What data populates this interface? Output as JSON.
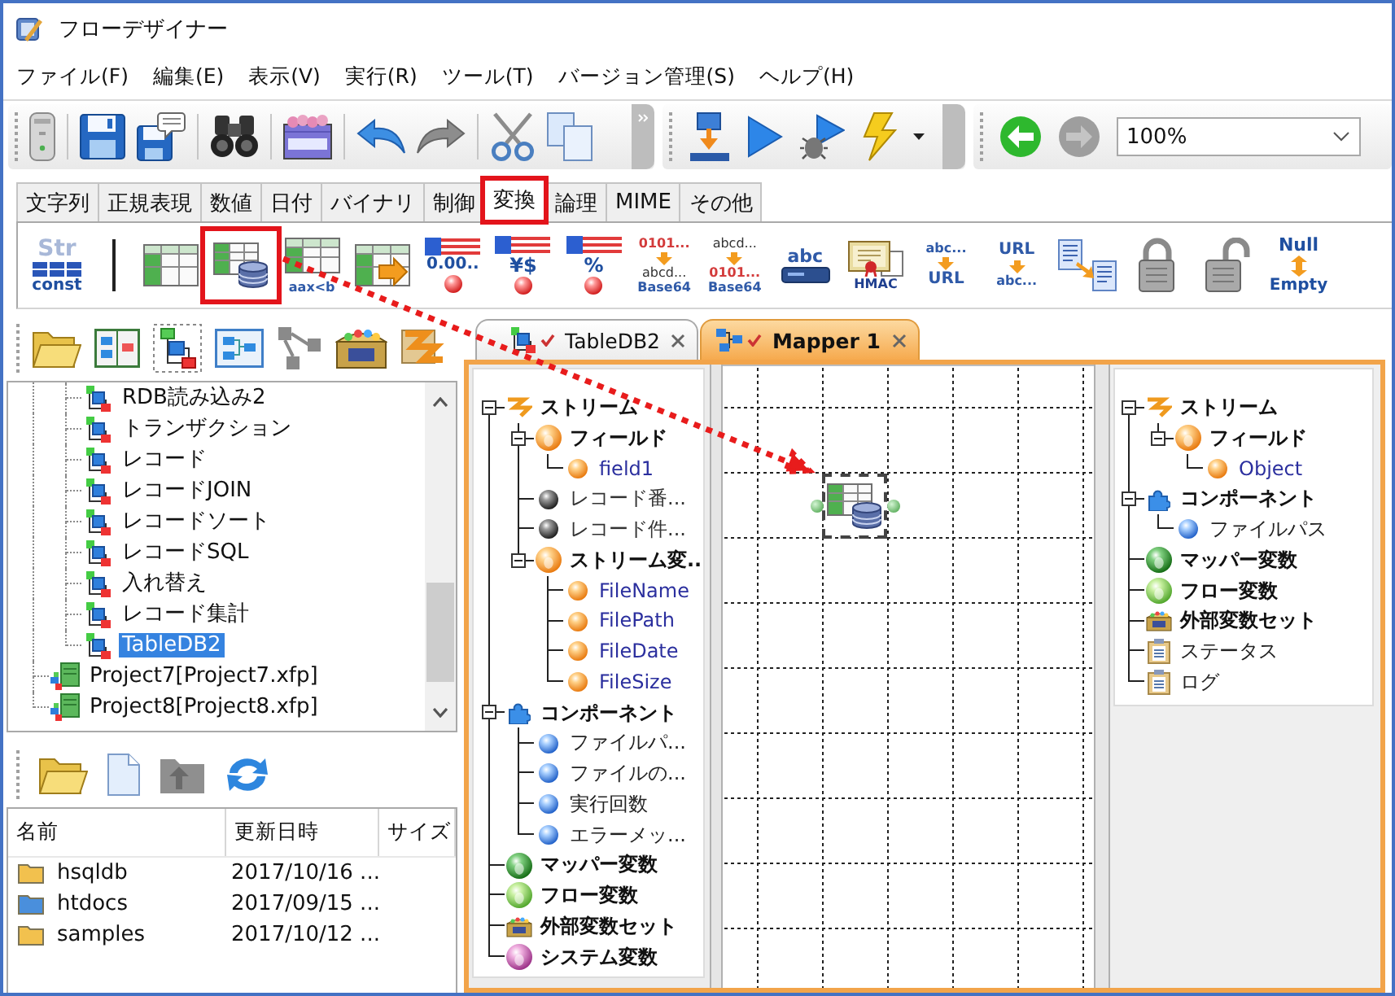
{
  "window": {
    "title": "フローデザイナー"
  },
  "menu": [
    "ファイル(F)",
    "編集(E)",
    "表示(V)",
    "実行(R)",
    "ツール(T)",
    "バージョン管理(S)",
    "ヘルプ(H)"
  ],
  "toolbar": {
    "zoom": "100%"
  },
  "category_tabs": [
    {
      "label": "文字列",
      "selected": false,
      "highlighted": false
    },
    {
      "label": "正規表現",
      "selected": false,
      "highlighted": false
    },
    {
      "label": "数値",
      "selected": false,
      "highlighted": false
    },
    {
      "label": "日付",
      "selected": false,
      "highlighted": false
    },
    {
      "label": "バイナリ",
      "selected": false,
      "highlighted": false
    },
    {
      "label": "制御",
      "selected": false,
      "highlighted": false
    },
    {
      "label": "変換",
      "selected": true,
      "highlighted": true
    },
    {
      "label": "論理",
      "selected": false,
      "highlighted": false
    },
    {
      "label": "MIME",
      "selected": false,
      "highlighted": false
    },
    {
      "label": "その他",
      "selected": false,
      "highlighted": false
    }
  ],
  "palette": [
    {
      "items": [
        {
          "kind": "const",
          "text": [
            "Str",
            "const"
          ],
          "highlighted": false
        }
      ]
    },
    {
      "items": [
        {
          "kind": "table",
          "highlighted": false
        },
        {
          "kind": "table-db",
          "highlighted": true
        },
        {
          "kind": "table-compare",
          "text": [
            "aax<b"
          ],
          "highlighted": false
        },
        {
          "kind": "table-convert",
          "highlighted": false
        },
        {
          "kind": "number-format",
          "text": [
            "0.00.."
          ],
          "highlighted": false
        },
        {
          "kind": "currency-format",
          "text": [
            "¥$"
          ],
          "highlighted": false
        },
        {
          "kind": "percent-format",
          "text": [
            "%"
          ],
          "highlighted": false
        },
        {
          "kind": "base64-encode",
          "text": [
            "0101...",
            "abcd...",
            "Base64"
          ],
          "highlighted": false
        },
        {
          "kind": "base64-decode",
          "text": [
            "abcd...",
            "0101...",
            "Base64"
          ],
          "highlighted": false
        },
        {
          "kind": "text-file",
          "text": [
            "abc"
          ],
          "highlighted": false
        },
        {
          "kind": "hmac",
          "text": [
            "HMAC"
          ],
          "highlighted": false
        },
        {
          "kind": "url-encode",
          "text": [
            "abc...",
            "URL"
          ],
          "highlighted": false
        },
        {
          "kind": "url-decode",
          "text": [
            "URL",
            "abc..."
          ],
          "highlighted": false
        },
        {
          "kind": "charset-convert",
          "highlighted": false
        },
        {
          "kind": "encrypt",
          "highlighted": false
        },
        {
          "kind": "decrypt",
          "highlighted": false
        },
        {
          "kind": "null-empty",
          "text": [
            "Null",
            "Empty"
          ],
          "highlighted": false
        }
      ]
    }
  ],
  "project_tree": [
    {
      "children": [
        {
          "label": "RDB読み込み2",
          "kind": "flow",
          "selected": false
        },
        {
          "label": "トランザクション",
          "kind": "flow",
          "selected": false
        },
        {
          "label": "レコード",
          "kind": "flow",
          "selected": false
        },
        {
          "label": "レコードJOIN",
          "kind": "flow",
          "selected": false
        },
        {
          "label": "レコードソート",
          "kind": "flow",
          "selected": false
        },
        {
          "label": "レコードSQL",
          "kind": "flow",
          "selected": false
        },
        {
          "label": "入れ替え",
          "kind": "flow",
          "selected": false
        },
        {
          "label": "レコード集計",
          "kind": "flow",
          "selected": false
        },
        {
          "label": "TableDB2",
          "kind": "flow",
          "selected": true
        }
      ]
    },
    {
      "label": "Project7[Project7.xfp]",
      "kind": "project",
      "selected": false
    },
    {
      "label": "Project8[Project8.xfp]",
      "kind": "project",
      "selected": false
    }
  ],
  "file_table": {
    "columns": [
      "名前",
      "更新日時",
      "サイズ"
    ],
    "rows": [
      {
        "name": "hsqldb",
        "modified": "2017/10/16 ...",
        "color": "#f2c14e"
      },
      {
        "name": "htdocs",
        "modified": "2017/09/15 ...",
        "color": "#4a8fdc"
      },
      {
        "name": "samples",
        "modified": "2017/10/12 ...",
        "color": "#f2c14e"
      }
    ]
  },
  "editor_tabs": [
    {
      "label": "TableDB2",
      "kind": "flow",
      "selected": false
    },
    {
      "label": "Mapper 1",
      "kind": "mapper",
      "selected": true
    }
  ],
  "mapper": {
    "input_tree": [
      {
        "label": "ストリーム",
        "kind": "stream",
        "expanded": true,
        "children": [
          {
            "label": "フィールド",
            "kind": "field-group",
            "expanded": true,
            "children": [
              {
                "label": "field1",
                "kind": "field"
              }
            ]
          },
          {
            "label": "レコード番...",
            "kind": "record-info"
          },
          {
            "label": "レコード件...",
            "kind": "record-info"
          },
          {
            "label": "ストリーム変...",
            "kind": "stream-var-group",
            "expanded": true,
            "children": [
              {
                "label": "FileName",
                "kind": "field"
              },
              {
                "label": "FilePath",
                "kind": "field"
              },
              {
                "label": "FileDate",
                "kind": "field"
              },
              {
                "label": "FileSize",
                "kind": "field"
              }
            ]
          }
        ]
      },
      {
        "label": "コンポーネント",
        "kind": "component",
        "expanded": true,
        "children": [
          {
            "label": "ファイルパ...",
            "kind": "component-var"
          },
          {
            "label": "ファイルの...",
            "kind": "component-var"
          },
          {
            "label": "実行回数",
            "kind": "component-var"
          },
          {
            "label": "エラーメッ...",
            "kind": "component-var"
          }
        ]
      },
      {
        "label": "マッパー変数",
        "kind": "mapper-var"
      },
      {
        "label": "フロー変数",
        "kind": "flow-var"
      },
      {
        "label": "外部変数セット",
        "kind": "external-var"
      },
      {
        "label": "システム変数",
        "kind": "system-var"
      }
    ],
    "canvas": {
      "nodes": [
        {
          "kind": "table-db",
          "selected": true
        }
      ]
    },
    "output_tree": [
      {
        "label": "ストリーム",
        "kind": "stream",
        "expanded": true,
        "children": [
          {
            "label": "フィールド",
            "kind": "field-group",
            "expanded": true,
            "children": [
              {
                "label": "Object",
                "kind": "field"
              }
            ]
          }
        ]
      },
      {
        "label": "コンポーネント",
        "kind": "component",
        "expanded": true,
        "children": [
          {
            "label": "ファイルパス",
            "kind": "component-var"
          }
        ]
      },
      {
        "label": "マッパー変数",
        "kind": "mapper-var"
      },
      {
        "label": "フロー変数",
        "kind": "flow-var"
      },
      {
        "label": "外部変数セット",
        "kind": "external-var"
      },
      {
        "label": "ステータス",
        "kind": "status"
      },
      {
        "label": "ログ",
        "kind": "log"
      }
    ]
  },
  "annotation": {
    "drag_arrow": true
  }
}
